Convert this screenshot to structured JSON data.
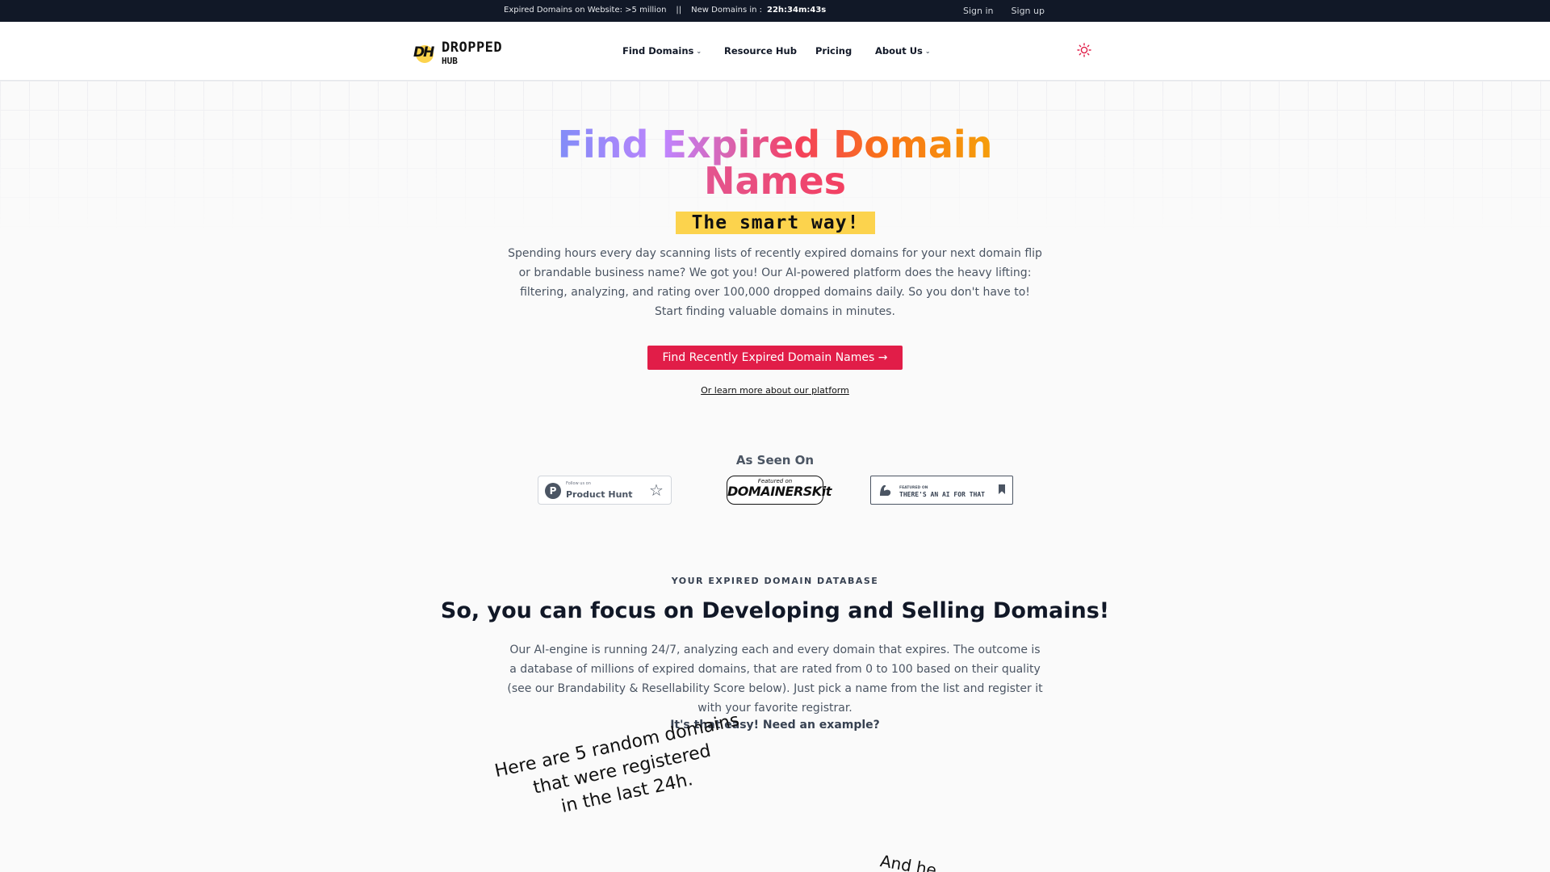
{
  "topbar": {
    "expired_label": "Expired Domains on Website: >5 million",
    "separator": "||",
    "new_label": "New Domains in :",
    "countdown": "22h:34m:43s",
    "signin": "Sign in",
    "signup": "Sign up"
  },
  "brand": {
    "name_line1": "DROPPED",
    "name_line2": "HUB",
    "mark": "DH"
  },
  "nav": {
    "items": [
      {
        "label": "Find Domains",
        "has_dropdown": true
      },
      {
        "label": "Resource Hub",
        "has_dropdown": false
      },
      {
        "label": "Pricing",
        "has_dropdown": false
      },
      {
        "label": "About Us",
        "has_dropdown": true
      }
    ],
    "theme_icon": "sun-icon"
  },
  "hero": {
    "title_line1": "Find Expired Domain",
    "title_line2": "Names",
    "tagline": "The smart way!",
    "lead": "Spending hours every day scanning lists of recently expired domains for your next domain flip or brandable business name? We got you! Our AI-powered platform does the heavy lifting: filtering, analyzing, and rating over 100,000 dropped domains daily. So you don't have to! Start finding valuable domains in minutes.",
    "cta": "Find Recently Expired Domain Names →",
    "learn_more": "Or learn more about our platform"
  },
  "as_seen_on": {
    "heading": "As Seen On",
    "badges": [
      {
        "small": "Follow us on",
        "big": "Product Hunt",
        "icon": "star-icon"
      },
      {
        "small": "Featured on",
        "big": "DOMAINERSKit"
      },
      {
        "small": "FEATURED ON",
        "big": "THERE'S AN AI FOR THAT",
        "icon": "bookmark-icon"
      }
    ]
  },
  "database": {
    "eyebrow": "YOUR EXPIRED DOMAIN DATABASE",
    "heading": "So, you can focus on Developing and Selling Domains!",
    "body": "Our AI-engine is running 24/7, analyzing each and every domain that expires. The outcome is a database of millions of expired domains, that are rated from 0 to 100 based on their quality (see our Brandability & Resellability Score below). Just pick a name from the list and register it with your favorite registrar.",
    "easy": "It's that easy! Need an example?"
  },
  "handwritten": {
    "note1_line1": "Here are 5 random domains",
    "note1_line2": "that were registered",
    "note1_line3": "in the last 24h.",
    "note2": "And he"
  },
  "colors": {
    "accent": "#e11d48",
    "highlight": "#fcd34d",
    "topbar_bg": "#111827"
  }
}
